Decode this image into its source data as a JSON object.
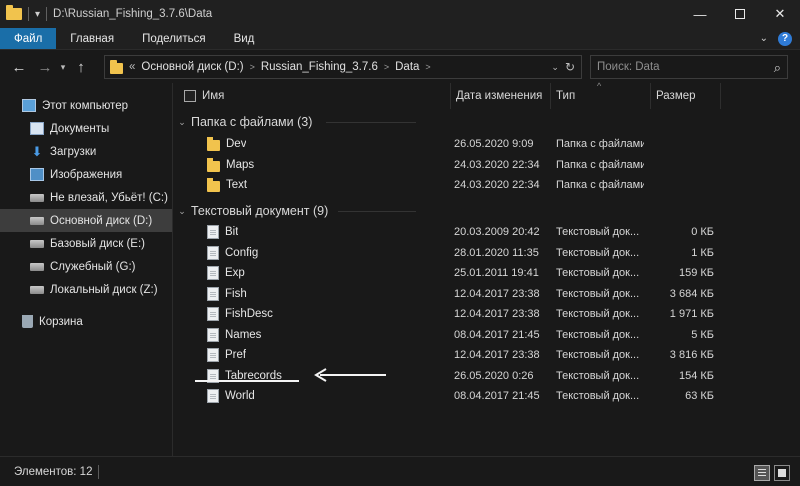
{
  "window": {
    "title": "D:\\Russian_Fishing_3.7.6\\Data"
  },
  "ribbon": {
    "tabs": [
      {
        "label": "Файл"
      },
      {
        "label": "Главная"
      },
      {
        "label": "Поделиться"
      },
      {
        "label": "Вид"
      }
    ]
  },
  "address": {
    "prefix": "«",
    "crumbs": [
      "Основной диск (D:)",
      "Russian_Fishing_3.7.6",
      "Data"
    ]
  },
  "search": {
    "placeholder": "Поиск: Data"
  },
  "sidebar": {
    "items": [
      {
        "label": "Этот компьютер",
        "icon": "computer-icon"
      },
      {
        "label": "Документы",
        "icon": "documents-icon"
      },
      {
        "label": "Загрузки",
        "icon": "downloads-icon"
      },
      {
        "label": "Изображения",
        "icon": "pictures-icon"
      },
      {
        "label": "Не влезай, Убьёт! (C:)",
        "icon": "drive-icon"
      },
      {
        "label": "Основной диск (D:)",
        "icon": "drive-icon"
      },
      {
        "label": "Базовый диск (E:)",
        "icon": "drive-icon"
      },
      {
        "label": "Служебный (G:)",
        "icon": "drive-icon"
      },
      {
        "label": "Локальный диск (Z:)",
        "icon": "drive-icon"
      },
      {
        "label": "Корзина",
        "icon": "recycle-bin-icon"
      }
    ]
  },
  "columns": {
    "name": "Имя",
    "date": "Дата изменения",
    "type": "Тип",
    "size": "Размер"
  },
  "groups": [
    {
      "label": "Папка с файлами (3)",
      "items": [
        {
          "name": "Dev",
          "date": "26.05.2020 9:09",
          "type": "Папка с файлами",
          "size": ""
        },
        {
          "name": "Maps",
          "date": "24.03.2020 22:34",
          "type": "Папка с файлами",
          "size": ""
        },
        {
          "name": "Text",
          "date": "24.03.2020 22:34",
          "type": "Папка с файлами",
          "size": ""
        }
      ]
    },
    {
      "label": "Текстовый документ (9)",
      "items": [
        {
          "name": "Bit",
          "date": "20.03.2009 20:42",
          "type": "Текстовый док...",
          "size": "0 КБ"
        },
        {
          "name": "Config",
          "date": "28.01.2020 11:35",
          "type": "Текстовый док...",
          "size": "1 КБ"
        },
        {
          "name": "Exp",
          "date": "25.01.2011 19:41",
          "type": "Текстовый док...",
          "size": "159 КБ"
        },
        {
          "name": "Fish",
          "date": "12.04.2017 23:38",
          "type": "Текстовый док...",
          "size": "3 684 КБ"
        },
        {
          "name": "FishDesc",
          "date": "12.04.2017 23:38",
          "type": "Текстовый док...",
          "size": "1 971 КБ"
        },
        {
          "name": "Names",
          "date": "08.04.2017 21:45",
          "type": "Текстовый док...",
          "size": "5 КБ"
        },
        {
          "name": "Pref",
          "date": "12.04.2017 23:38",
          "type": "Текстовый док...",
          "size": "3 816 КБ"
        },
        {
          "name": "Tabrecords",
          "date": "26.05.2020 0:26",
          "type": "Текстовый док...",
          "size": "154 КБ"
        },
        {
          "name": "World",
          "date": "08.04.2017 21:45",
          "type": "Текстовый док...",
          "size": "63 КБ"
        }
      ]
    }
  ],
  "status": {
    "count_label": "Элементов: 12"
  },
  "colors": {
    "accent": "#1a6ea8",
    "folder": "#f1c34d",
    "background": "#191919"
  }
}
